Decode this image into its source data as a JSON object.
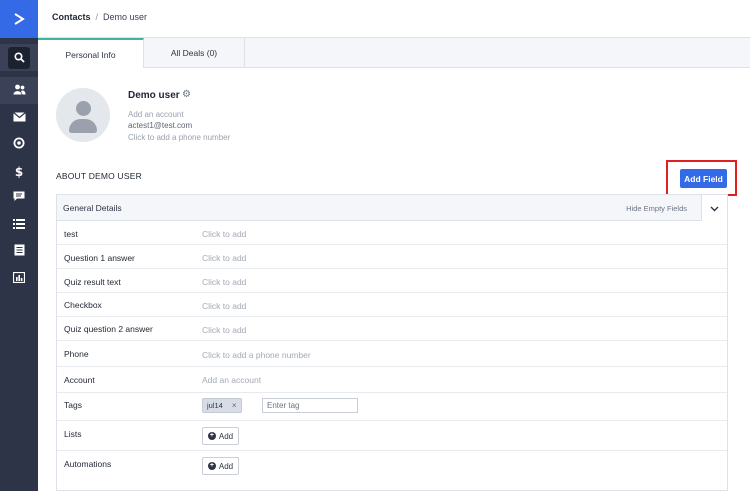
{
  "breadcrumb": {
    "root": "Contacts",
    "separator": "/",
    "current": "Demo user"
  },
  "tabs": [
    {
      "label": "Personal Info",
      "active": true
    },
    {
      "label": "All Deals (0)",
      "active": false
    }
  ],
  "contact": {
    "name": "Demo user",
    "account_placeholder": "Add an account",
    "email": "actest1@test.com",
    "phone_placeholder": "Click to add a phone number"
  },
  "about": {
    "title": "ABOUT DEMO USER",
    "add_field_label": "Add Field"
  },
  "panel": {
    "title": "General Details",
    "hide_empty_label": "Hide Empty Fields",
    "fields": [
      {
        "label": "test",
        "value": "Click to add"
      },
      {
        "label": "Question 1 answer",
        "value": "Click to add"
      },
      {
        "label": "Quiz result text",
        "value": "Click to add"
      },
      {
        "label": "Checkbox",
        "value": "Click to add"
      },
      {
        "label": "Quiz question 2 answer",
        "value": "Click to add"
      },
      {
        "label": "Phone",
        "value": "Click to add a phone number"
      },
      {
        "label": "Account",
        "value": "Add an account"
      }
    ],
    "tags": {
      "label": "Tags",
      "chip": "jul14",
      "chip_remove": "×",
      "input_placeholder": "Enter tag"
    },
    "lists": {
      "label": "Lists",
      "button": "Add"
    },
    "automations": {
      "label": "Automations",
      "button": "Add"
    }
  },
  "sidebar_icons": [
    "logo-icon",
    "search-icon",
    "contacts-icon",
    "mail-icon",
    "activity-icon",
    "deals-icon",
    "conversations-icon",
    "lists-icon",
    "forms-icon",
    "reports-icon"
  ],
  "colors": {
    "sidebar": "#2e3447",
    "brand_blue": "#356ae6",
    "highlight_red": "#e0201e",
    "tab_accent": "#3cb6a1"
  }
}
